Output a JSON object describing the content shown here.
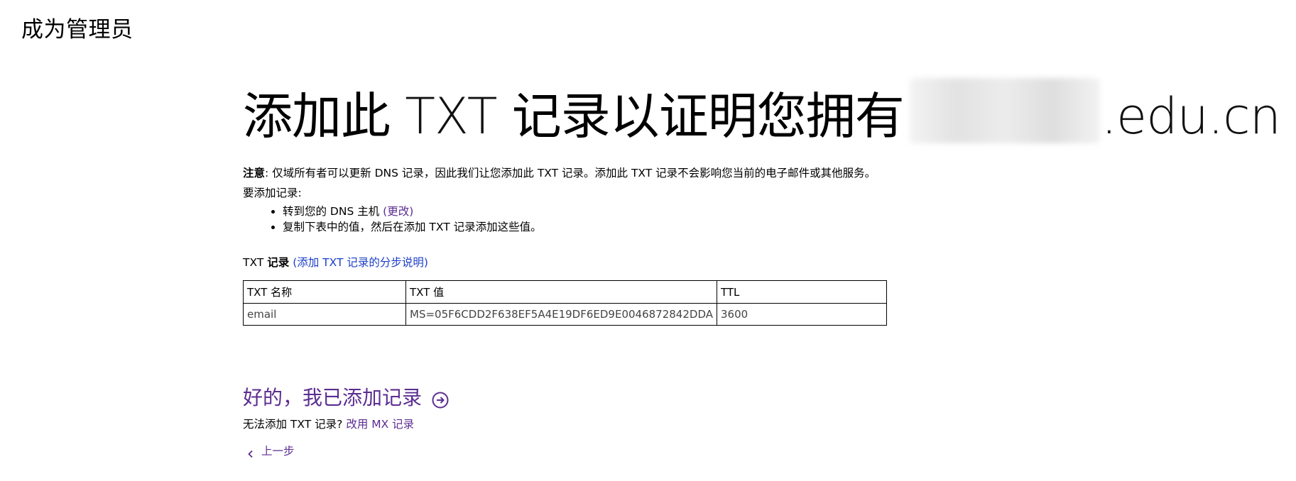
{
  "header": {
    "title": "成为管理员"
  },
  "main": {
    "title_prefix": "添加此",
    "title_txt": "TXT",
    "title_middle": "记录以证明您拥有",
    "title_domain_suffix": ".edu.cn"
  },
  "note": {
    "label": "注意",
    "text": ": 仅域所有者可以更新 DNS 记录，因此我们让您添加此 TXT 记录。添加此 TXT 记录不会影响您当前的电子邮件或其他服务。"
  },
  "instructions": {
    "intro": "要添加记录:",
    "step1_text": "转到您的 DNS 主机",
    "step1_link": "(更改)",
    "step2_text": "复制下表中的值，然后在添加 TXT 记录添加这些值。"
  },
  "txt_section": {
    "label_prefix": "TXT",
    "label_bold": "记录",
    "help_link": "(添加 TXT 记录的分步说明)"
  },
  "table": {
    "headers": [
      "TXT 名称",
      "TXT 值",
      "TTL"
    ],
    "rows": [
      [
        "email",
        "MS=05F6CDD2F638EF5A4E19DF6ED9E0046872842DDA",
        "3600"
      ]
    ]
  },
  "actions": {
    "confirm_label": "好的，我已添加记录",
    "confirm_icon": "arrow-circle-right-icon",
    "alt_text": "无法添加 TXT 记录?",
    "alt_link": "改用 MX 记录",
    "back_label": "上一步",
    "back_icon": "chevron-left-icon"
  },
  "colors": {
    "accent_purple": "#5c2d91",
    "link_blue": "#1a3ec9"
  }
}
